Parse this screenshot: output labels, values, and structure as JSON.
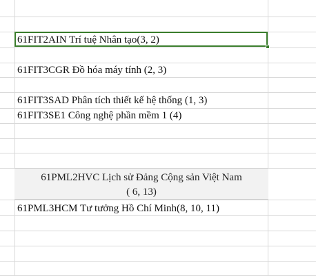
{
  "cells": {
    "c1": "61FIT2AIN Trí tuệ Nhân tạo(3, 2)",
    "c2": "61FIT3CGR Đồ hóa máy tính (2, 3)",
    "c3": "61FIT3SAD Phân tích thiết kế hệ thống (1,  3)",
    "c4": "61FIT3SE1 Công nghệ phần mềm 1 (4)",
    "merged_line1": "61PML2HVC Lịch sử Đảng Cộng sản Việt Nam",
    "merged_line2": "( 6, 13)",
    "c6": "61PML3HCM Tư tưởng Hồ Chí Minh(8, 10, 11)"
  },
  "colors": {
    "selection_border": "#3a7d2c",
    "gridline": "#d9d9d9",
    "merged_fill": "#f2f2f2"
  }
}
